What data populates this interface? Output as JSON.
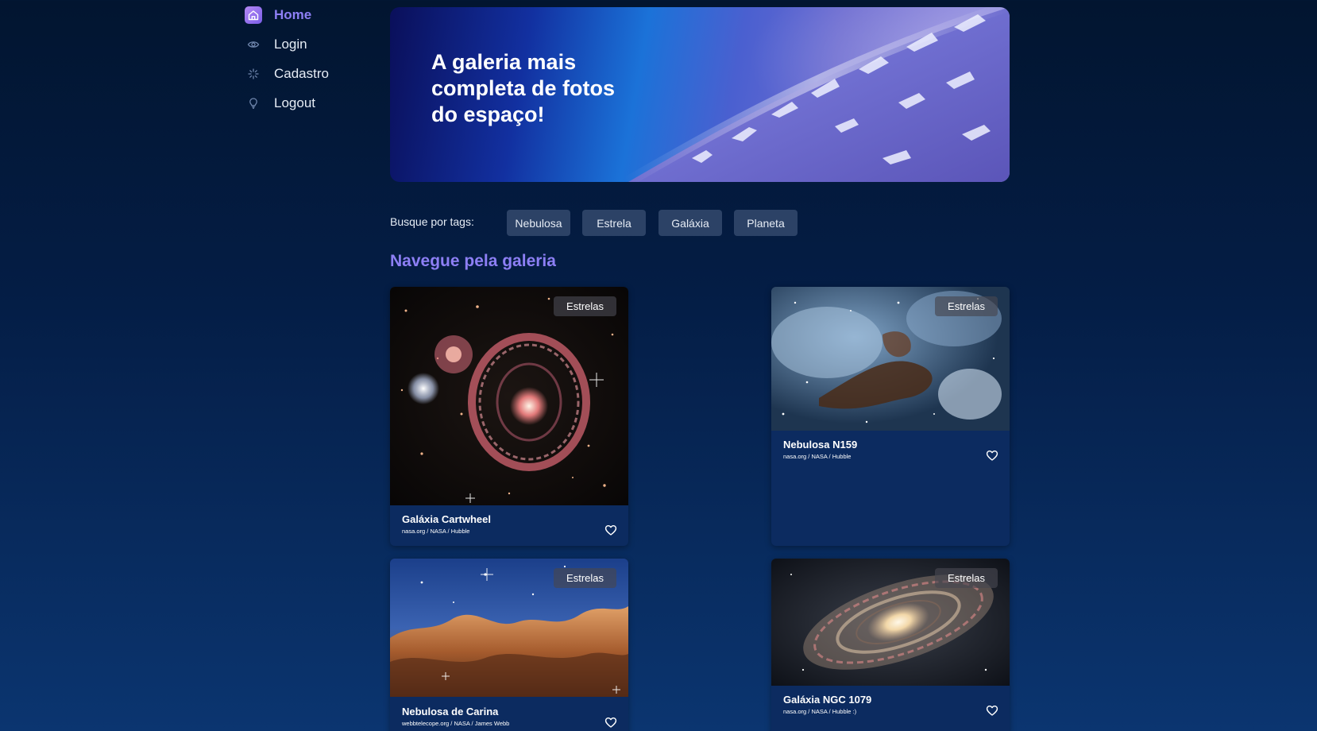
{
  "sidebar": {
    "items": [
      {
        "label": "Home",
        "icon": "home-icon",
        "active": true
      },
      {
        "label": "Login",
        "icon": "eye-icon",
        "active": false
      },
      {
        "label": "Cadastro",
        "icon": "sparkle-icon",
        "active": false
      },
      {
        "label": "Logout",
        "icon": "lightbulb-icon",
        "active": false
      }
    ]
  },
  "banner": {
    "title": "A galeria mais completa de fotos do espaço!"
  },
  "tags": {
    "label": "Busque por tags:",
    "items": [
      "Nebulosa",
      "Estrela",
      "Galáxia",
      "Planeta"
    ]
  },
  "gallery": {
    "title": "Navegue pela galeria",
    "cards": [
      {
        "title": "Galáxia Cartwheel",
        "credit": "nasa.org / NASA / Hubble",
        "badge": "Estrelas"
      },
      {
        "title": "Nebulosa N159",
        "credit": "nasa.org / NASA / Hubble",
        "badge": "Estrelas"
      },
      {
        "title": "Nebulosa de Carina",
        "credit": "webbtelecope.org / NASA / James Webb",
        "badge": "Estrelas"
      },
      {
        "title": "Galáxia NGC 1079",
        "credit": "nasa.org / NASA / Hubble :)",
        "badge": "Estrelas"
      }
    ]
  },
  "colors": {
    "accent": "#8d7ff5",
    "background_top": "#021530",
    "background_bottom": "#0b3570",
    "card": "#0c2b60",
    "tag": "#2c4266"
  }
}
